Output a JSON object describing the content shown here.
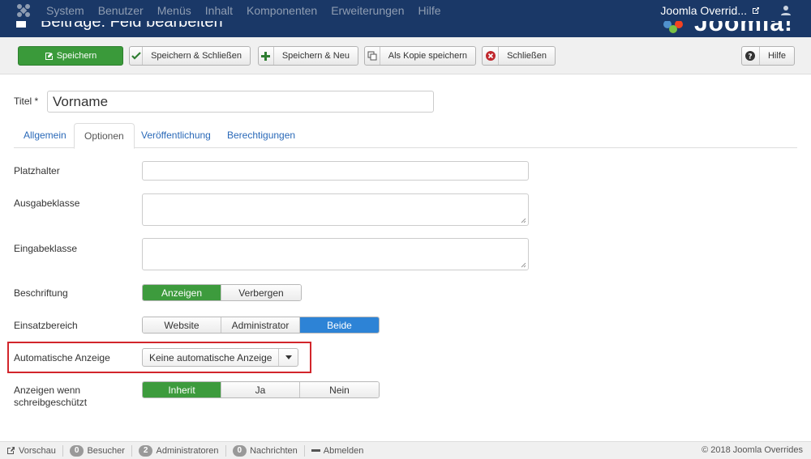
{
  "navbar": {
    "menu": [
      "System",
      "Benutzer",
      "Menüs",
      "Inhalt",
      "Komponenten",
      "Erweiterungen",
      "Hilfe"
    ],
    "site_name": "Joomla Overrid...",
    "logo_icon": "joomla-logo-icon",
    "user_icon": "user-icon"
  },
  "header": {
    "page_title": "Beiträge: Feld bearbeiten",
    "brand": "Joomla!"
  },
  "toolbar": {
    "save": "Speichern",
    "save_close": "Speichern & Schließen",
    "save_new": "Speichern & Neu",
    "save_copy": "Als Kopie speichern",
    "close": "Schließen",
    "help": "Hilfe"
  },
  "form": {
    "title_label": "Titel *",
    "title_value": "Vorname",
    "tabs": [
      "Allgemein",
      "Optionen",
      "Veröffentlichung",
      "Berechtigungen"
    ],
    "active_tab": "Optionen",
    "placeholder_label": "Platzhalter",
    "output_class_label": "Ausgabeklasse",
    "input_class_label": "Eingabeklasse",
    "caption": {
      "label": "Beschriftung",
      "options": [
        "Anzeigen",
        "Verbergen"
      ],
      "selected": "Anzeigen"
    },
    "scope": {
      "label": "Einsatzbereich",
      "options": [
        "Website",
        "Administrator",
        "Beide"
      ],
      "selected": "Beide"
    },
    "auto_display": {
      "label": "Automatische Anzeige",
      "selected": "Keine automatische Anzeige"
    },
    "readonly": {
      "label_line1": "Anzeigen wenn",
      "label_line2": "schreibgeschützt",
      "options": [
        "Inherit",
        "Ja",
        "Nein"
      ],
      "selected": "Inherit"
    }
  },
  "statusbar": {
    "preview": "Vorschau",
    "visitors_count": "0",
    "visitors": "Besucher",
    "admins_count": "2",
    "admins": "Administratoren",
    "messages_count": "0",
    "messages": "Nachrichten",
    "logout": "Abmelden",
    "copyright": "© 2018 Joomla Overrides"
  },
  "colors": {
    "navbar": "#1a3867",
    "save_green": "#3a9a3a",
    "active_blue": "#2d83d6",
    "highlight_red": "#d2252b"
  }
}
